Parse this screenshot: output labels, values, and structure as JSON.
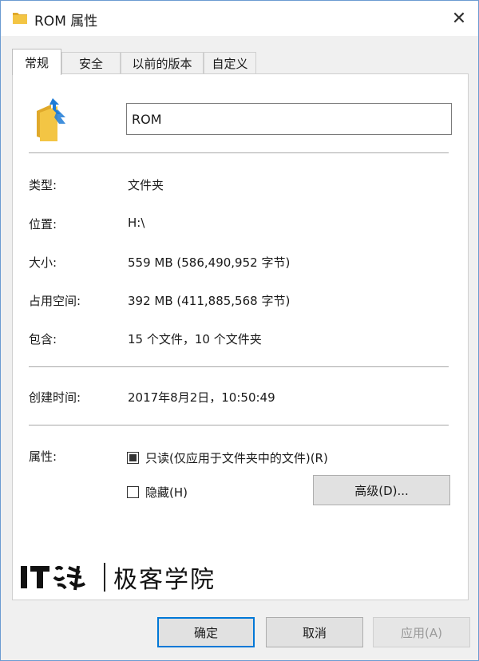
{
  "window": {
    "title": "ROM 属性",
    "close_glyph": "✕"
  },
  "tabs": [
    {
      "label": "常规",
      "active": true
    },
    {
      "label": "安全",
      "active": false
    },
    {
      "label": "以前的版本",
      "active": false
    },
    {
      "label": "自定义",
      "active": false
    }
  ],
  "general": {
    "name_value": "ROM",
    "icon": "folder-icon",
    "type": {
      "label": "类型:",
      "value": "文件夹"
    },
    "location": {
      "label": "位置:",
      "value": "H:\\"
    },
    "size": {
      "label": "大小:",
      "value": "559 MB (586,490,952 字节)"
    },
    "size_on_disk": {
      "label": "占用空间:",
      "value": "392 MB (411,885,568 字节)"
    },
    "contains": {
      "label": "包含:",
      "value": "15 个文件，10 个文件夹"
    },
    "created": {
      "label": "创建时间:",
      "value": "2017年8月2日，10:50:49"
    },
    "attributes": {
      "label": "属性:",
      "readonly": {
        "label": "只读(仅应用于文件夹中的文件)(R)",
        "state": "indeterminate"
      },
      "hidden": {
        "label": "隐藏(H)",
        "state": "unchecked"
      },
      "advanced_button": "高级(D)..."
    }
  },
  "watermark": {
    "logo_text": "IT之家",
    "text": "极客学院"
  },
  "buttons": {
    "ok": "确定",
    "cancel": "取消",
    "apply": "应用(A)"
  },
  "colors": {
    "folder": "#f3c544",
    "folder_dark": "#e0a92a",
    "share_arrow": "#1e7bd6",
    "default_button_border": "#0078d7"
  }
}
